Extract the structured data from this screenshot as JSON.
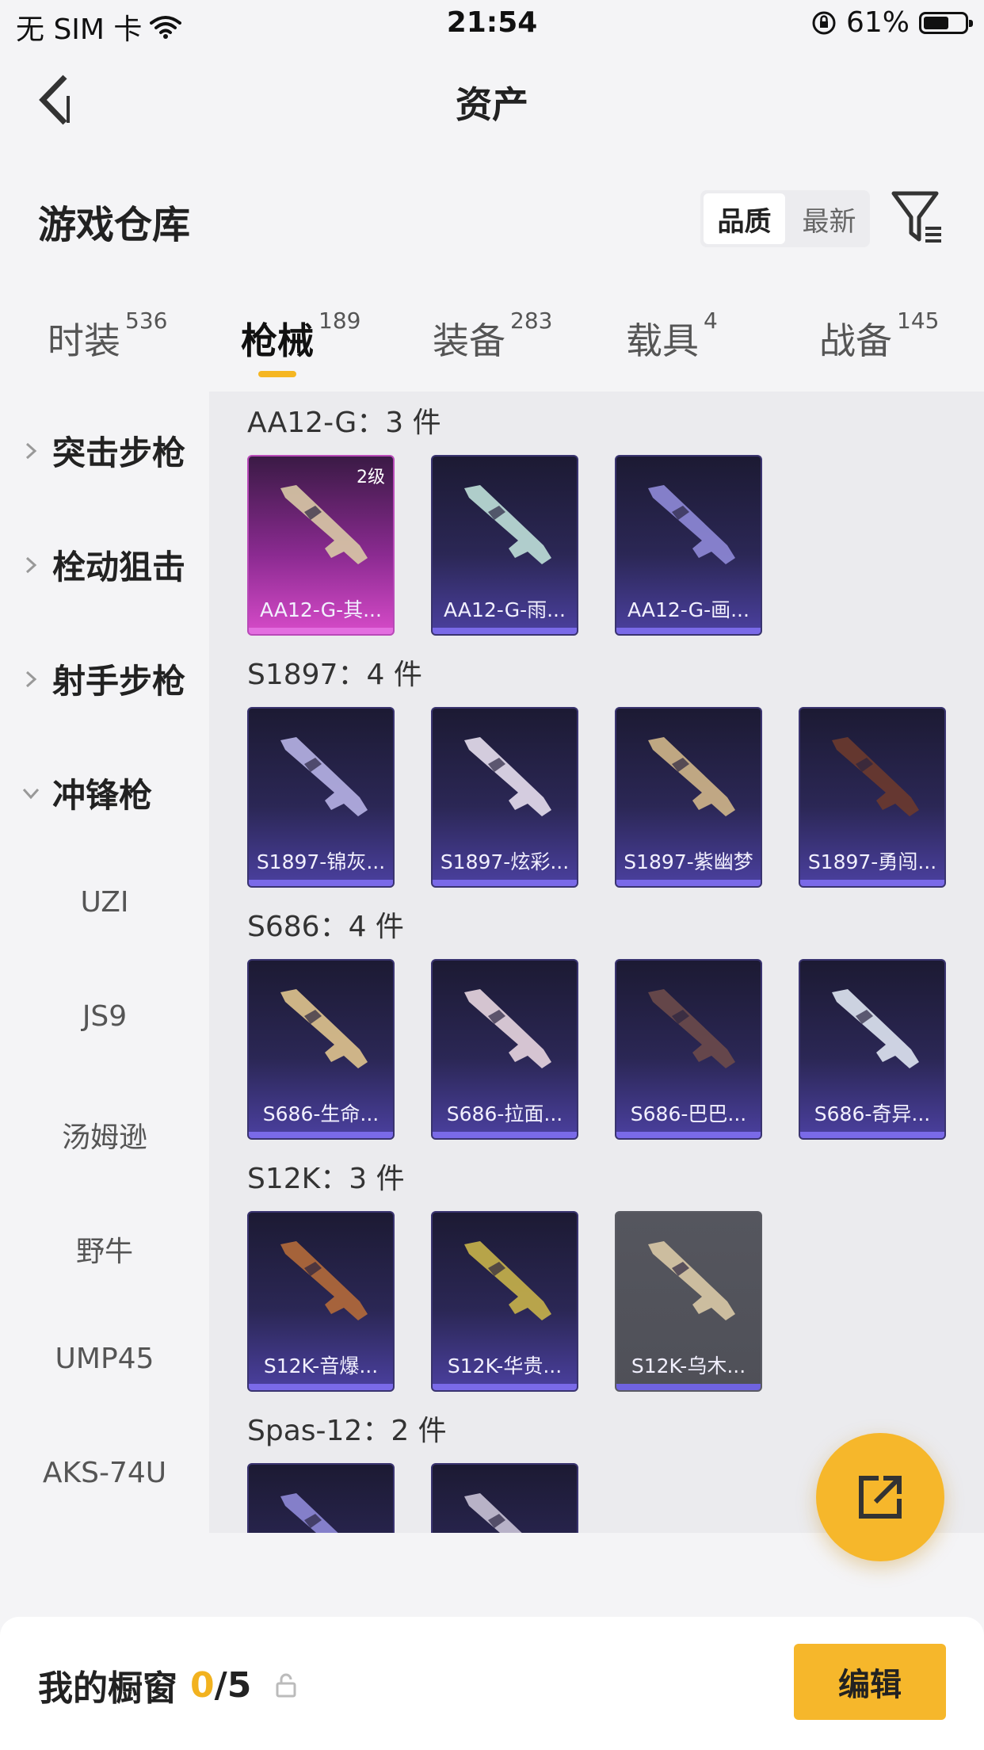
{
  "status": {
    "carrier": "无 SIM 卡",
    "time": "21:54",
    "battery": "61%",
    "battery_level": 0.61
  },
  "nav": {
    "title": "资产"
  },
  "header": {
    "title": "游戏仓库",
    "sort_options": [
      "品质",
      "最新"
    ],
    "sort_selected": "品质"
  },
  "tabs": [
    {
      "label": "时装",
      "count": "536"
    },
    {
      "label": "枪械",
      "count": "189"
    },
    {
      "label": "装备",
      "count": "283"
    },
    {
      "label": "载具",
      "count": "4"
    },
    {
      "label": "战备",
      "count": "145"
    }
  ],
  "active_tab": "枪械",
  "sidebar": {
    "categories": [
      {
        "label": "突击步枪",
        "expanded": false
      },
      {
        "label": "栓动狙击",
        "expanded": false
      },
      {
        "label": "射手步枪",
        "expanded": false
      },
      {
        "label": "冲锋枪",
        "expanded": true
      }
    ],
    "subitems": [
      "UZI",
      "JS9",
      "汤姆逊",
      "野牛",
      "UMP45",
      "AKS-74U"
    ]
  },
  "groups": [
    {
      "title": "AA12-G：3 件",
      "items": [
        {
          "name": "AA12-G-其...",
          "level": "2级",
          "style": "pink"
        },
        {
          "name": "AA12-G-雨...",
          "style": "purple"
        },
        {
          "name": "AA12-G-画...",
          "style": "purple"
        }
      ]
    },
    {
      "title": "S1897：4 件",
      "items": [
        {
          "name": "S1897-锦灰...",
          "style": "purple"
        },
        {
          "name": "S1897-炫彩...",
          "style": "purple"
        },
        {
          "name": "S1897-紫幽梦",
          "style": "purple"
        },
        {
          "name": "S1897-勇闯...",
          "style": "purple"
        }
      ]
    },
    {
      "title": "S686：4 件",
      "items": [
        {
          "name": "S686-生命...",
          "style": "purple"
        },
        {
          "name": "S686-拉面...",
          "style": "purple"
        },
        {
          "name": "S686-巴巴...",
          "style": "purple"
        },
        {
          "name": "S686-奇异...",
          "style": "purple"
        }
      ]
    },
    {
      "title": "S12K：3 件",
      "items": [
        {
          "name": "S12K-音爆...",
          "style": "purple"
        },
        {
          "name": "S12K-华贵...",
          "style": "purple"
        },
        {
          "name": "S12K-乌木...",
          "style": "gray"
        }
      ]
    },
    {
      "title": "Spas-12：2 件",
      "items": [
        {
          "name": "",
          "style": "purple"
        },
        {
          "name": "",
          "style": "purple"
        }
      ]
    }
  ],
  "showcase": {
    "label": "我的橱窗",
    "current": "0",
    "total": "/5",
    "edit_label": "编辑"
  },
  "colors": {
    "accent": "#f6b72b",
    "card_purple": "#4b40a0",
    "card_pink": "#d74bc9",
    "card_gray": "#55565e"
  },
  "icons": {
    "back": "chevron-left-icon",
    "filter": "filter-icon",
    "share": "share-export-icon",
    "lock": "lock-icon",
    "wifi": "wifi-icon",
    "rotation_lock": "rotation-lock-icon"
  }
}
